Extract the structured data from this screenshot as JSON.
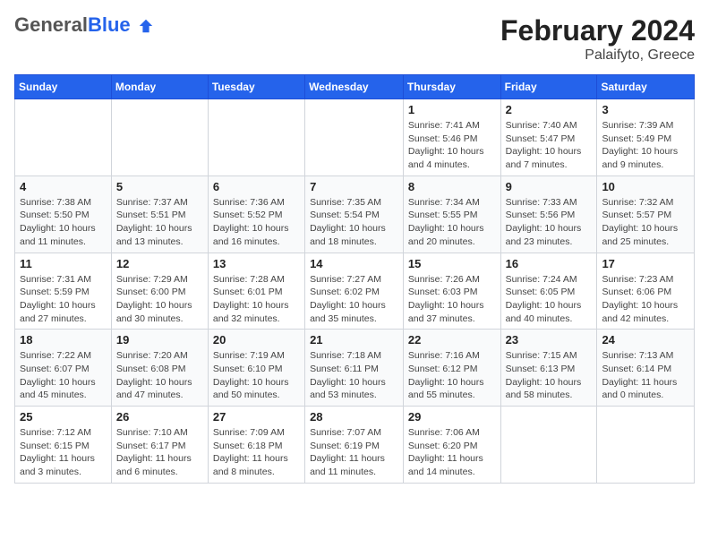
{
  "logo": {
    "general": "General",
    "blue": "Blue"
  },
  "title": "February 2024",
  "subtitle": "Palaifyto, Greece",
  "days": [
    "Sunday",
    "Monday",
    "Tuesday",
    "Wednesday",
    "Thursday",
    "Friday",
    "Saturday"
  ],
  "weeks": [
    [
      {
        "date": "",
        "info": ""
      },
      {
        "date": "",
        "info": ""
      },
      {
        "date": "",
        "info": ""
      },
      {
        "date": "",
        "info": ""
      },
      {
        "date": "1",
        "info": "Sunrise: 7:41 AM\nSunset: 5:46 PM\nDaylight: 10 hours and 4 minutes."
      },
      {
        "date": "2",
        "info": "Sunrise: 7:40 AM\nSunset: 5:47 PM\nDaylight: 10 hours and 7 minutes."
      },
      {
        "date": "3",
        "info": "Sunrise: 7:39 AM\nSunset: 5:49 PM\nDaylight: 10 hours and 9 minutes."
      }
    ],
    [
      {
        "date": "4",
        "info": "Sunrise: 7:38 AM\nSunset: 5:50 PM\nDaylight: 10 hours and 11 minutes."
      },
      {
        "date": "5",
        "info": "Sunrise: 7:37 AM\nSunset: 5:51 PM\nDaylight: 10 hours and 13 minutes."
      },
      {
        "date": "6",
        "info": "Sunrise: 7:36 AM\nSunset: 5:52 PM\nDaylight: 10 hours and 16 minutes."
      },
      {
        "date": "7",
        "info": "Sunrise: 7:35 AM\nSunset: 5:54 PM\nDaylight: 10 hours and 18 minutes."
      },
      {
        "date": "8",
        "info": "Sunrise: 7:34 AM\nSunset: 5:55 PM\nDaylight: 10 hours and 20 minutes."
      },
      {
        "date": "9",
        "info": "Sunrise: 7:33 AM\nSunset: 5:56 PM\nDaylight: 10 hours and 23 minutes."
      },
      {
        "date": "10",
        "info": "Sunrise: 7:32 AM\nSunset: 5:57 PM\nDaylight: 10 hours and 25 minutes."
      }
    ],
    [
      {
        "date": "11",
        "info": "Sunrise: 7:31 AM\nSunset: 5:59 PM\nDaylight: 10 hours and 27 minutes."
      },
      {
        "date": "12",
        "info": "Sunrise: 7:29 AM\nSunset: 6:00 PM\nDaylight: 10 hours and 30 minutes."
      },
      {
        "date": "13",
        "info": "Sunrise: 7:28 AM\nSunset: 6:01 PM\nDaylight: 10 hours and 32 minutes."
      },
      {
        "date": "14",
        "info": "Sunrise: 7:27 AM\nSunset: 6:02 PM\nDaylight: 10 hours and 35 minutes."
      },
      {
        "date": "15",
        "info": "Sunrise: 7:26 AM\nSunset: 6:03 PM\nDaylight: 10 hours and 37 minutes."
      },
      {
        "date": "16",
        "info": "Sunrise: 7:24 AM\nSunset: 6:05 PM\nDaylight: 10 hours and 40 minutes."
      },
      {
        "date": "17",
        "info": "Sunrise: 7:23 AM\nSunset: 6:06 PM\nDaylight: 10 hours and 42 minutes."
      }
    ],
    [
      {
        "date": "18",
        "info": "Sunrise: 7:22 AM\nSunset: 6:07 PM\nDaylight: 10 hours and 45 minutes."
      },
      {
        "date": "19",
        "info": "Sunrise: 7:20 AM\nSunset: 6:08 PM\nDaylight: 10 hours and 47 minutes."
      },
      {
        "date": "20",
        "info": "Sunrise: 7:19 AM\nSunset: 6:10 PM\nDaylight: 10 hours and 50 minutes."
      },
      {
        "date": "21",
        "info": "Sunrise: 7:18 AM\nSunset: 6:11 PM\nDaylight: 10 hours and 53 minutes."
      },
      {
        "date": "22",
        "info": "Sunrise: 7:16 AM\nSunset: 6:12 PM\nDaylight: 10 hours and 55 minutes."
      },
      {
        "date": "23",
        "info": "Sunrise: 7:15 AM\nSunset: 6:13 PM\nDaylight: 10 hours and 58 minutes."
      },
      {
        "date": "24",
        "info": "Sunrise: 7:13 AM\nSunset: 6:14 PM\nDaylight: 11 hours and 0 minutes."
      }
    ],
    [
      {
        "date": "25",
        "info": "Sunrise: 7:12 AM\nSunset: 6:15 PM\nDaylight: 11 hours and 3 minutes."
      },
      {
        "date": "26",
        "info": "Sunrise: 7:10 AM\nSunset: 6:17 PM\nDaylight: 11 hours and 6 minutes."
      },
      {
        "date": "27",
        "info": "Sunrise: 7:09 AM\nSunset: 6:18 PM\nDaylight: 11 hours and 8 minutes."
      },
      {
        "date": "28",
        "info": "Sunrise: 7:07 AM\nSunset: 6:19 PM\nDaylight: 11 hours and 11 minutes."
      },
      {
        "date": "29",
        "info": "Sunrise: 7:06 AM\nSunset: 6:20 PM\nDaylight: 11 hours and 14 minutes."
      },
      {
        "date": "",
        "info": ""
      },
      {
        "date": "",
        "info": ""
      }
    ]
  ]
}
